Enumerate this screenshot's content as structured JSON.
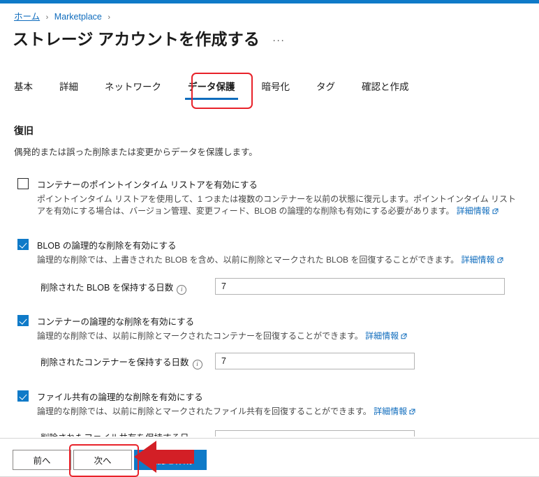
{
  "breadcrumb": {
    "items": [
      {
        "label": "ホーム",
        "underlined": true
      },
      {
        "label": "Marketplace",
        "underlined": false
      }
    ],
    "separator": "›"
  },
  "header": {
    "title": "ストレージ アカウントを作成する",
    "more_label": "···"
  },
  "tabs": [
    {
      "label": "基本",
      "active": false
    },
    {
      "label": "詳細",
      "active": false
    },
    {
      "label": "ネットワーク",
      "active": false
    },
    {
      "label": "データ保護",
      "active": true
    },
    {
      "label": "暗号化",
      "active": false
    },
    {
      "label": "タグ",
      "active": false
    },
    {
      "label": "確認と作成",
      "active": false
    }
  ],
  "main": {
    "section_heading": "復旧",
    "section_description": "偶発的または誤った削除または変更からデータを保護します。",
    "learn_more_label": "詳細情報",
    "info_icon": "info-icon",
    "external_link_icon": "external-link-icon",
    "options": [
      {
        "id": "point-in-time-restore",
        "checked": false,
        "label": "コンテナーのポイントインタイム リストアを有効にする",
        "description_line1": "ポイントインタイム リストアを使用して、1 つまたは複数のコンテナーを以前の状態に復元します。ポイントインタイム リスト",
        "description_line2": "アを有効にする場合は、バージョン管理、変更フィード、BLOB の論理的な削除も有効にする必要があります。"
      },
      {
        "id": "blob-soft-delete",
        "checked": true,
        "label": "BLOB の論理的な削除を有効にする",
        "description_line1": "論理的な削除では、上書きされた BLOB を含め、以前に削除とマークされた BLOB を回復することができます。",
        "description_line2": ""
      },
      {
        "id": "container-soft-delete",
        "checked": true,
        "label": "コンテナーの論理的な削除を有効にする",
        "description_line1": "論理的な削除では、以前に削除とマークされたコンテナーを回復することができます。",
        "description_line2": ""
      },
      {
        "id": "file-share-soft-delete",
        "checked": true,
        "label": "ファイル共有の論理的な削除を有効にする",
        "description_line1": "論理的な削除では、以前に削除とマークされたファイル共有を回復することができます。",
        "description_line2": ""
      }
    ],
    "fields": [
      {
        "id": "blob-retention-days",
        "label": "削除された BLOB を保持する日数",
        "value": "7"
      },
      {
        "id": "container-retention-days",
        "label": "削除されたコンテナーを保持する日数",
        "value": "7"
      },
      {
        "id": "file-share-retention-days",
        "label": "削除されたファイル共有を保持する日",
        "value": ""
      }
    ]
  },
  "footer": {
    "previous_label": "前へ",
    "next_label": "次へ",
    "review_create_label": "確認と作成"
  },
  "annotations": {
    "tab_highlight_color": "#e8222a",
    "button_highlight_color": "#e8222a",
    "arrow_color": "#d31f26",
    "arrow_direction": "left"
  },
  "theme": {
    "accent": "#0f7ac8",
    "link": "#0f6cbd",
    "text": "#1b1b1b",
    "muted_text": "#494949",
    "border": "#b3b3b3"
  }
}
